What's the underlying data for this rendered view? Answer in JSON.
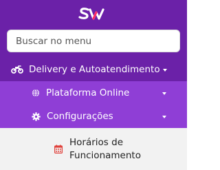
{
  "logo": {
    "text": "SW",
    "accent_color": "#ff2e63"
  },
  "search": {
    "placeholder": "Buscar no menu"
  },
  "menu": {
    "level1": {
      "label": "Delivery e Autoatendimento",
      "icon": "motorcycle-icon"
    },
    "level2": [
      {
        "label": "Plataforma Online",
        "icon": "globe-icon"
      },
      {
        "label": "Configurações",
        "icon": "gear-icon"
      }
    ],
    "level3": {
      "label": "Horários de Funcionamento",
      "icon": "calendar-icon"
    }
  },
  "colors": {
    "sidebar_bg": "#6b21a8",
    "submenu_bg": "#8f3ed6",
    "active_bg": "#f2f2f2",
    "calendar_icon": "#e0403a"
  }
}
